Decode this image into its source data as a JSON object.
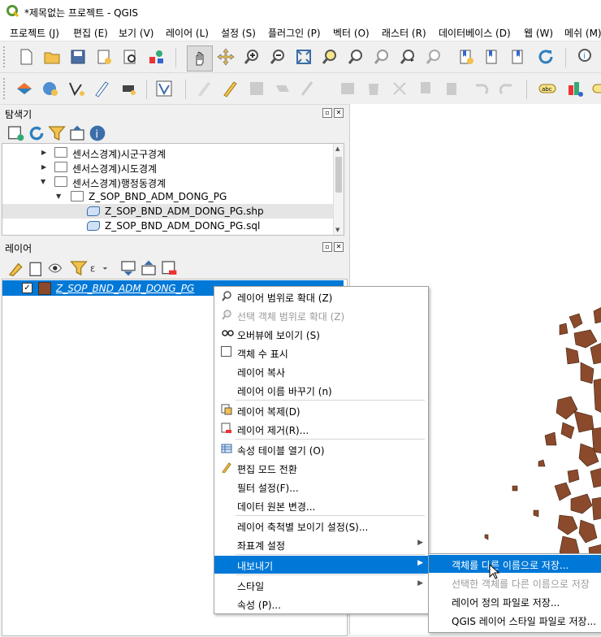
{
  "window": {
    "title": "*제목없는 프로젝트 - QGIS"
  },
  "menubar": [
    "프로젝트 (J)",
    "편집 (E)",
    "보기 (V)",
    "레이어 (L)",
    "설정 (S)",
    "플러그인 (P)",
    "벡터 (O)",
    "래스터 (R)",
    "데이터베이스 (D)",
    "웹 (W)",
    "메쉬 (M)"
  ],
  "browser": {
    "title": "탐색기",
    "items": [
      {
        "label": "센서스경계)시군구경계",
        "indent": 0,
        "expanded": false,
        "type": "folder"
      },
      {
        "label": "센서스경계)시도경계",
        "indent": 0,
        "expanded": false,
        "type": "folder"
      },
      {
        "label": "센서스경계)행정동경계",
        "indent": 0,
        "expanded": true,
        "type": "folder"
      },
      {
        "label": "Z_SOP_BND_ADM_DONG_PG",
        "indent": 1,
        "expanded": true,
        "type": "folder"
      },
      {
        "label": "Z_SOP_BND_ADM_DONG_PG.shp",
        "indent": 2,
        "type": "shp",
        "selected": true
      },
      {
        "label": "Z_SOP_BND_ADM_DONG_PG.sql",
        "indent": 2,
        "type": "shp"
      }
    ]
  },
  "layers": {
    "title": "레이어",
    "items": [
      {
        "label": "Z_SOP_BND_ADM_DONG_PG",
        "checked": true,
        "color": "#8b4a2b"
      }
    ]
  },
  "context_menu": {
    "items": [
      {
        "label": "레이어 범위로 확대 (Z)",
        "icon": "zoom-layer-icon"
      },
      {
        "label": "선택 객체 범위로 확대 (Z)",
        "icon": "zoom-selection-icon",
        "disabled": true
      },
      {
        "label": "오버뷰에 보이기 (S)",
        "icon": "overview-icon"
      },
      {
        "label": "객체 수 표시",
        "icon": "checkbox-icon"
      },
      {
        "label": "레이어 복사"
      },
      {
        "label": "레이어 이름 바꾸기 (n)"
      },
      {
        "sep": true
      },
      {
        "label": "레이어 복제(D)",
        "icon": "duplicate-layer-icon"
      },
      {
        "label": "레이어 제거(R)...",
        "icon": "remove-layer-icon"
      },
      {
        "sep": true
      },
      {
        "label": "속성 테이블 열기 (O)",
        "icon": "attribute-table-icon"
      },
      {
        "label": "편집 모드 전환",
        "icon": "pencil-icon"
      },
      {
        "label": "필터 설정(F)..."
      },
      {
        "label": "데이터 원본 변경..."
      },
      {
        "sep": true
      },
      {
        "label": "레이어 축척별 보이기 설정(S)..."
      },
      {
        "label": "좌표계 설정",
        "submenu": true
      },
      {
        "sep": true
      },
      {
        "label": "내보내기",
        "submenu": true,
        "highlighted": true
      },
      {
        "sep": true
      },
      {
        "label": "스타일",
        "submenu": true
      },
      {
        "label": "속성 (P)..."
      }
    ]
  },
  "export_submenu": {
    "items": [
      {
        "label": "객체를 다른 이름으로 저장...",
        "highlighted": true
      },
      {
        "label": "선택한 객체를 다른 이름으로 저장",
        "disabled": true
      },
      {
        "label": "레이어 정의 파일로 저장..."
      },
      {
        "label": "QGIS 레이어 스타일 파일로 저장..."
      }
    ]
  },
  "colors": {
    "highlight": "#0078d7",
    "map_fill": "#8b4a2b",
    "qgis_green": "#589632"
  }
}
